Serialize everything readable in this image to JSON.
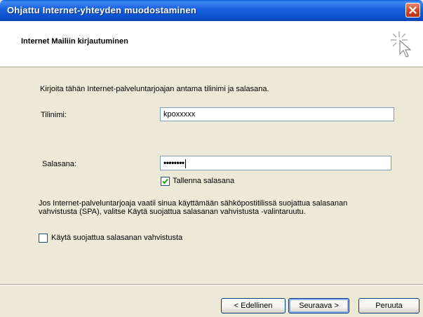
{
  "window": {
    "title": "Ohjattu Internet-yhteyden muodostaminen"
  },
  "header": {
    "title": "Internet Mailiin kirjautuminen"
  },
  "form": {
    "instruction": "Kirjoita tähän Internet-palveluntarjoajan antama tilinimi ja salasana.",
    "username_label": "Tilinimi:",
    "username_value": "kpoxxxxx",
    "password_label": "Salasana:",
    "password_dots": "••••••••",
    "save_password_label": "Tallenna salasana",
    "save_password_checked": true,
    "spa_paragraph": "Jos Internet-palveluntarjoaja vaatii sinua käyttämään sähköpostitilissä suojattua salasanan vahvistusta (SPA), valitse Käytä suojattua salasanan vahvistusta -valintaruutu.",
    "spa_label": "Käytä suojattua salasanan vahvistusta",
    "spa_checked": false
  },
  "buttons": {
    "back": "< Edellinen",
    "next": "Seuraava >",
    "cancel": "Peruuta"
  },
  "icons": {
    "close": "close-icon",
    "wizard": "wizard-cursor-icon",
    "check": "checkmark-icon"
  },
  "colors": {
    "titlebar": "#0A4FC9",
    "dialog_bg": "#ECE9D8",
    "close_button": "#D24A2A"
  }
}
